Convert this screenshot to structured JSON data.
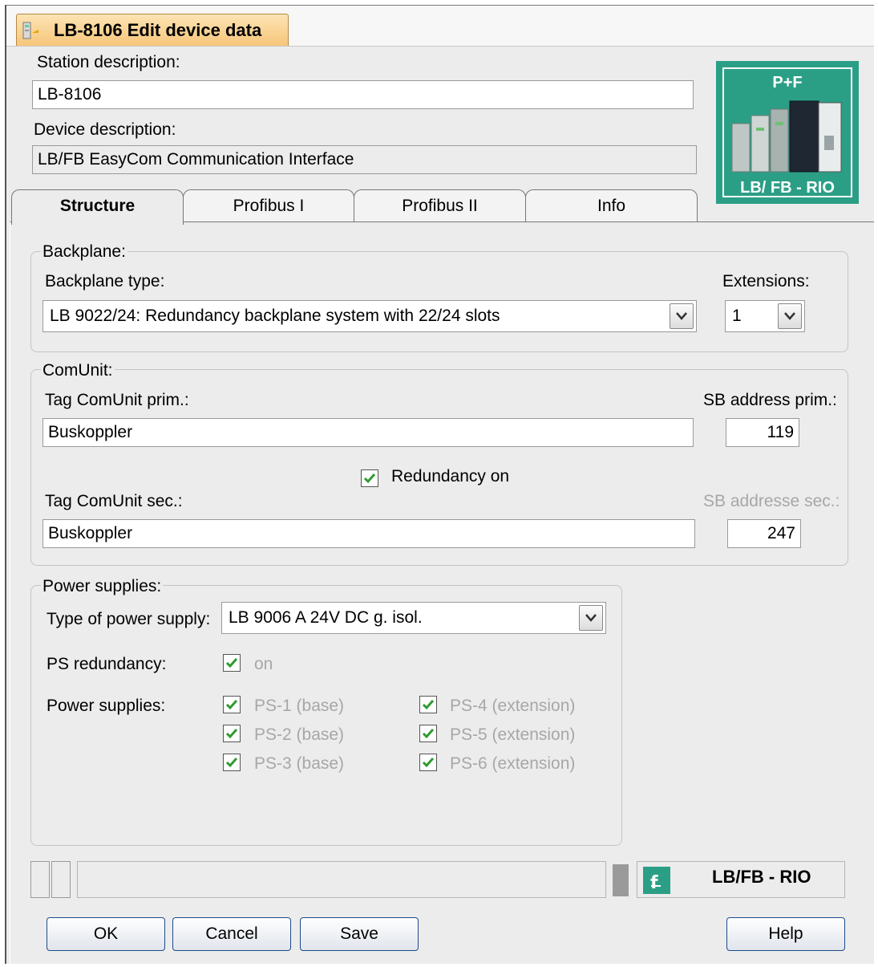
{
  "window": {
    "title": "LB-8106 Edit device data"
  },
  "station": {
    "label": "Station description:",
    "value": "LB-8106"
  },
  "device": {
    "label": "Device description:",
    "value": "LB/FB EasyCom Communication Interface"
  },
  "logo": {
    "top_text": "P+F",
    "bottom_text": "LB/ FB - RIO"
  },
  "tabs": [
    {
      "label": "Structure",
      "active": true
    },
    {
      "label": "Profibus I",
      "active": false
    },
    {
      "label": "Profibus II",
      "active": false
    },
    {
      "label": "Info",
      "active": false
    }
  ],
  "backplane": {
    "group_label": "Backplane:",
    "type_label": "Backplane type:",
    "type_value": "LB 9022/24: Redundancy backplane system with 22/24 slots",
    "extensions_label": "Extensions:",
    "extensions_value": "1"
  },
  "comunit": {
    "group_label": "ComUnit:",
    "prim_label": "Tag ComUnit prim.:",
    "prim_value": "Buskoppler",
    "sb_prim_label": "SB address prim.:",
    "sb_prim_value": "119",
    "redundancy_label": "Redundancy on",
    "redundancy_checked": true,
    "sec_label": "Tag ComUnit sec.:",
    "sec_value": "Buskoppler",
    "sb_sec_label": "SB addresse sec.:",
    "sb_sec_value": "247"
  },
  "power": {
    "group_label": "Power supplies:",
    "type_label": "Type of power supply:",
    "type_value": "LB 9006 A 24V DC g. isol.",
    "redundancy_label": "PS redundancy:",
    "redundancy_on_label": "on",
    "supplies_label": "Power supplies:",
    "supplies": [
      {
        "label": "PS-1 (base)",
        "checked": true
      },
      {
        "label": "PS-2 (base)",
        "checked": true
      },
      {
        "label": "PS-3 (base)",
        "checked": true
      },
      {
        "label": "PS-4 (extension)",
        "checked": true
      },
      {
        "label": "PS-5 (extension)",
        "checked": true
      },
      {
        "label": "PS-6 (extension)",
        "checked": true
      }
    ]
  },
  "statusbar": {
    "product": "LB/FB - RIO"
  },
  "buttons": {
    "ok": "OK",
    "cancel": "Cancel",
    "save": "Save",
    "help": "Help"
  },
  "colors": {
    "accent": "#2b9f86",
    "title_tab": "#f6c67a",
    "check": "#2f9a2f"
  }
}
